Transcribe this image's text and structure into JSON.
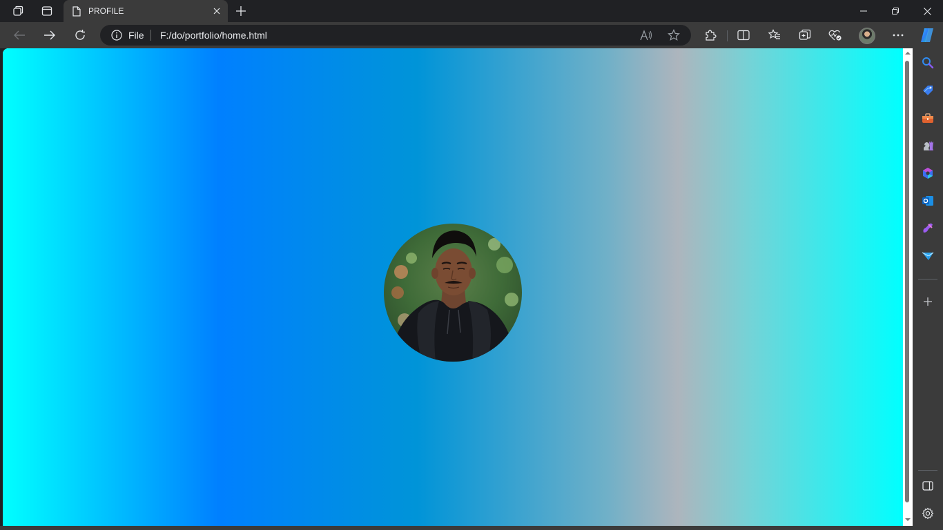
{
  "tab": {
    "title": "PROFILE"
  },
  "address": {
    "scheme_label": "File",
    "url": "F:/do/portfolio/home.html"
  },
  "page": {
    "background_colors": [
      "#00ffff",
      "#0080ff",
      "#0094d8",
      "#adb5bd",
      "#00ffff"
    ],
    "photo_alt": "Profile photo of a young man in a black hoodie"
  },
  "icons": {
    "workspaces": "workspaces-icon",
    "tab_actions": "tab-actions-icon",
    "back": "back-arrow-icon",
    "forward": "forward-arrow-icon",
    "refresh": "refresh-icon",
    "read_aloud": "read-aloud-icon",
    "favorite": "star-icon",
    "extensions": "puzzle-icon",
    "split_screen": "split-screen-icon",
    "favorites": "favorites-icon",
    "collections": "collections-icon",
    "browser_essentials": "heart-icon",
    "more": "more-icon",
    "copilot": "copilot-icon"
  },
  "sidebar": {
    "items": [
      "search",
      "shopping",
      "tools",
      "games",
      "microsoft-365",
      "outlook",
      "designer",
      "drop"
    ]
  }
}
